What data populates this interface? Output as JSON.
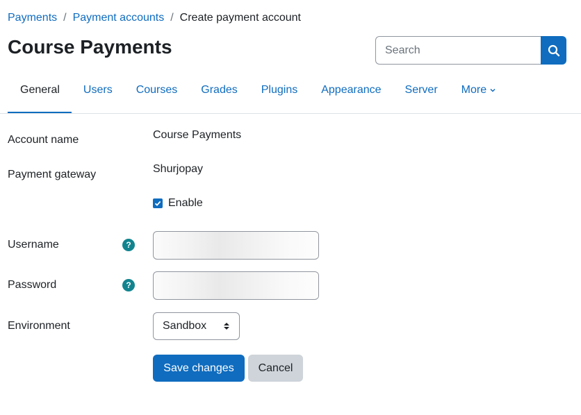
{
  "breadcrumb": {
    "items": [
      "Payments",
      "Payment accounts"
    ],
    "separator": "/",
    "current": "Create payment account"
  },
  "page": {
    "title": "Course Payments"
  },
  "search": {
    "placeholder": "Search",
    "icon": "search-icon"
  },
  "nav": {
    "tabs": [
      {
        "label": "General",
        "active": true
      },
      {
        "label": "Users"
      },
      {
        "label": "Courses"
      },
      {
        "label": "Grades"
      },
      {
        "label": "Plugins"
      },
      {
        "label": "Appearance"
      },
      {
        "label": "Server"
      },
      {
        "label": "More"
      }
    ]
  },
  "form": {
    "account_name": {
      "label": "Account name",
      "value": "Course Payments"
    },
    "payment_gateway": {
      "label": "Payment gateway",
      "value": "Shurjopay"
    },
    "enable": {
      "label": "Enable",
      "checked": true
    },
    "username": {
      "label": "Username",
      "help": "?"
    },
    "password": {
      "label": "Password",
      "help": "?"
    },
    "environment": {
      "label": "Environment",
      "selected": "Sandbox"
    },
    "save_label": "Save changes",
    "cancel_label": "Cancel"
  },
  "colors": {
    "accent": "#0f6cbf",
    "help": "#11848f",
    "text": "#1d2125",
    "secondary_button": "#ced4da"
  }
}
